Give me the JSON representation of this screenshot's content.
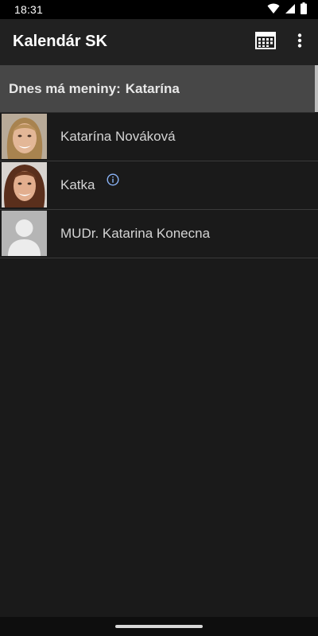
{
  "status_bar": {
    "time": "18:31",
    "icons": [
      "wifi-icon",
      "signal-icon",
      "battery-icon"
    ]
  },
  "app_bar": {
    "title": "Kalendár SK",
    "actions": [
      "calendar-icon",
      "more-vert-icon"
    ]
  },
  "nameday": {
    "label": "Dnes má meniny:",
    "name": "Katarína"
  },
  "contacts": [
    {
      "name": "Katarína Nováková",
      "avatar": "photo",
      "has_info": false
    },
    {
      "name": "Katka",
      "avatar": "photo",
      "has_info": true
    },
    {
      "name": "MUDr. Katarina Konecna",
      "avatar": "placeholder",
      "has_info": false
    }
  ],
  "colors": {
    "background": "#1a1a1a",
    "app_bar": "#212121",
    "nameday_banner": "#474747",
    "info_icon": "#8ab4f8"
  }
}
